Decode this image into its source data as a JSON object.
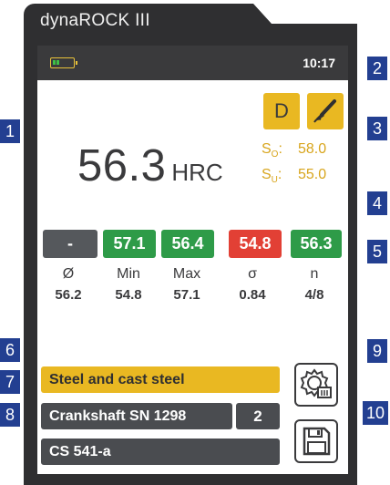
{
  "device": {
    "brand": "dynaROCK III"
  },
  "status": {
    "time": "10:17"
  },
  "probe": {
    "type_label": "D"
  },
  "reading": {
    "value": "56.3",
    "unit": "HRC"
  },
  "limits": {
    "upper_label": "S",
    "upper_sub": "O",
    "upper_sep": ":",
    "upper_value": "58.0",
    "lower_label": "S",
    "lower_sub": "U",
    "lower_sep": ":",
    "lower_value": "55.0"
  },
  "measurements": [
    {
      "label": "-",
      "status": "gray"
    },
    {
      "label": "57.1",
      "status": "green"
    },
    {
      "label": "56.4",
      "status": "green"
    },
    {
      "label": "54.8",
      "status": "red"
    },
    {
      "label": "56.3",
      "status": "green"
    }
  ],
  "stats": [
    {
      "label": "Ø",
      "value": "56.2"
    },
    {
      "label": "Min",
      "value": "54.8"
    },
    {
      "label": "Max",
      "value": "57.1"
    },
    {
      "label": "σ",
      "value": "0.84"
    },
    {
      "label": "n",
      "value": "4/8"
    }
  ],
  "fields": {
    "material": "Steel and cast steel",
    "part": "Crankshaft SN 1298",
    "count": "2",
    "cs": "CS 541-a"
  },
  "callouts": {
    "c1": "1",
    "c2": "2",
    "c3": "3",
    "c4": "4",
    "c5": "5",
    "c6": "6",
    "c7": "7",
    "c8": "8",
    "c9": "9",
    "c10": "10"
  },
  "colors": {
    "accent": "#e9b822",
    "ok": "#2e9b48",
    "error": "#e24035",
    "neutral": "#55585c",
    "callout": "#233f91"
  },
  "icons": {
    "probe": "impact-probe-icon",
    "settings": "gear-settings-icon",
    "save": "floppy-disk-icon",
    "battery": "battery-icon"
  }
}
